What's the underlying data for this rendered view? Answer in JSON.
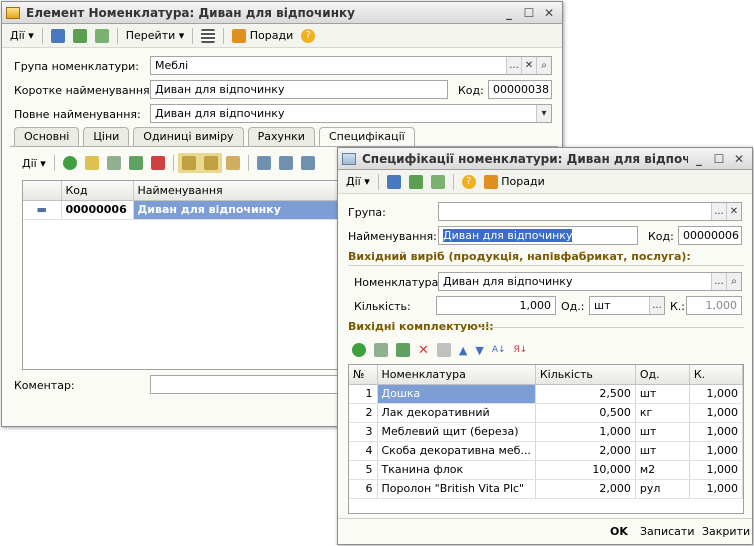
{
  "main_window": {
    "title": "Елемент Номенклатура: Диван для відпочинку",
    "toolbar": {
      "actions": "Дії",
      "goto": "Перейти",
      "tips": "Поради"
    },
    "group_label": "Група номенклатури:",
    "group_value": "Меблі",
    "short_name_label": "Коротке найменування:",
    "short_name_value": "Диван для відпочинку",
    "code_label": "Код:",
    "code_value": "00000038",
    "full_name_label": "Повне найменування:",
    "full_name_value": "Диван для відпочинку",
    "tabs": [
      "Основні",
      "Ціни",
      "Одиниці виміру",
      "Рахунки",
      "Специфікації"
    ],
    "spec_toolbar_actions": "Дії",
    "grid_headers": {
      "code": "Код",
      "name": "Найменування"
    },
    "grid_row": {
      "code": "00000006",
      "name": "Диван для відпочинку"
    },
    "comment_label": "Коментар:"
  },
  "spec_window": {
    "title": "Специфікації номенклатури: Диван для відпочинку",
    "toolbar": {
      "actions": "Дії",
      "tips": "Поради"
    },
    "group_label": "Група:",
    "group_value": "",
    "name_label": "Найменування:",
    "name_value": "Диван для відпочинку",
    "code_label": "Код:",
    "code_value": "00000006",
    "output_section": "Вихідний виріб (продукція, напівфабрикат, послуга):",
    "nomen_label": "Номенклатура:",
    "nomen_value": "Диван для відпочинку",
    "qty_label": "Кількість:",
    "qty_value": "1,000",
    "unit_label": "Од.:",
    "unit_value": "шт",
    "k_label": "К.:",
    "k_value": "1,000",
    "components_section": "Вихідні комплектуючі:",
    "table_headers": {
      "no": "№",
      "nomen": "Номенклатура",
      "qty": "Кількість",
      "unit": "Од.",
      "k": "К."
    },
    "rows": [
      {
        "no": "1",
        "nomen": "Дошка",
        "qty": "2,500",
        "unit": "шт",
        "k": "1,000"
      },
      {
        "no": "2",
        "nomen": "Лак декоративний",
        "qty": "0,500",
        "unit": "кг",
        "k": "1,000"
      },
      {
        "no": "3",
        "nomen": "Меблевий щит (береза)",
        "qty": "1,000",
        "unit": "шт",
        "k": "1,000"
      },
      {
        "no": "4",
        "nomen": "Скоба декоративна меб...",
        "qty": "2,000",
        "unit": "шт",
        "k": "1,000"
      },
      {
        "no": "5",
        "nomen": "Тканина флок",
        "qty": "10,000",
        "unit": "м2",
        "k": "1,000"
      },
      {
        "no": "6",
        "nomen": "Поролон \"British Vita Plc\"",
        "qty": "2,000",
        "unit": "рул",
        "k": "1,000"
      }
    ],
    "footer": {
      "ok": "OK",
      "save": "Записати",
      "close": "Закрити"
    }
  }
}
